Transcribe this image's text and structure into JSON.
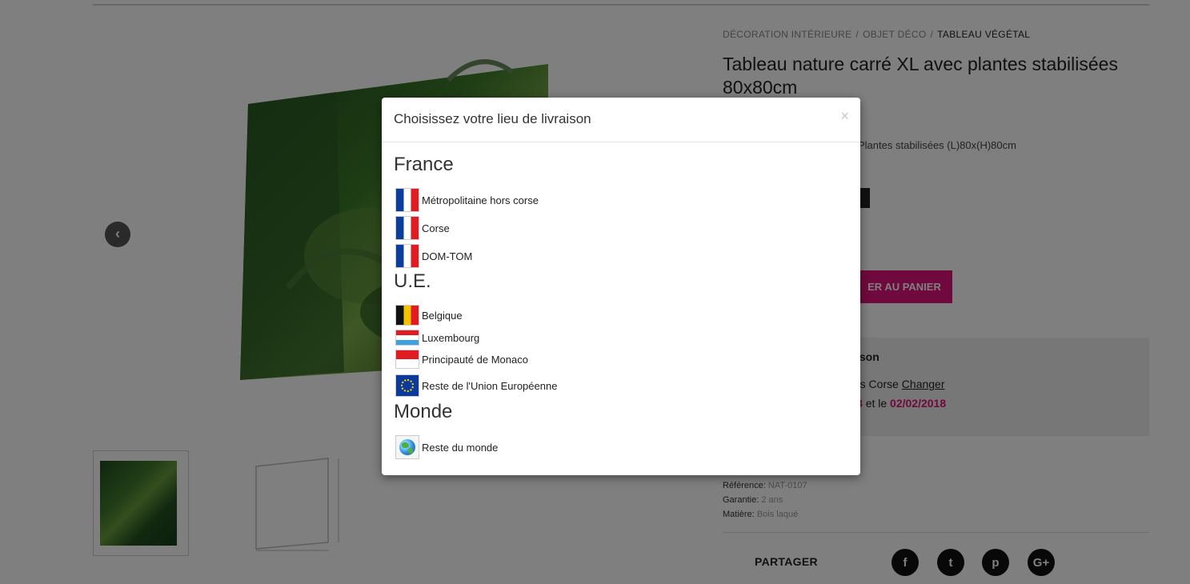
{
  "breadcrumb": [
    {
      "label": "DÉCORATION INTÉRIEURE"
    },
    {
      "label": "OBJET DÉCO"
    },
    {
      "label": "TABLEAU VÉGÉTAL"
    }
  ],
  "product": {
    "title": "Tableau nature carré XL avec plantes stabilisées 80x80cm",
    "description_visible": "Plantes stabilisées (L)80x(H)80cm",
    "add_to_cart_label": "ER AU PANIER",
    "delivery": {
      "title": "ison",
      "line1_text": "rs Corse",
      "change_link": "Changer",
      "line2_date1": "8",
      "line2_mid": "et le",
      "line2_date2": "02/02/2018"
    },
    "specs": [
      {
        "label": "Référence:",
        "value": "NAT-0107"
      },
      {
        "label": "Garantie:",
        "value": "2 ans"
      },
      {
        "label": "Matière:",
        "value": "Bois laqué"
      }
    ],
    "share_label": "PARTAGER",
    "social": [
      {
        "name": "facebook-icon",
        "glyph": "f"
      },
      {
        "name": "twitter-icon",
        "glyph": "t"
      },
      {
        "name": "pinterest-icon",
        "glyph": "p"
      },
      {
        "name": "google-plus-icon",
        "glyph": "G+"
      }
    ]
  },
  "modal": {
    "title": "Choisissez votre lieu de livraison",
    "close_glyph": "×",
    "regions": [
      {
        "heading": "France",
        "options": [
          "Métropolitaine hors corse",
          "Corse",
          "DOM-TOM"
        ]
      },
      {
        "heading": "U.E.",
        "options": [
          "Belgique",
          "Luxembourg",
          "Principauté de Monaco",
          "Reste de l'Union Européenne"
        ]
      },
      {
        "heading": "Monde",
        "options": [
          "Reste du monde"
        ]
      }
    ]
  },
  "colors": {
    "accent_pink": "#e0137a",
    "overlay": "rgba(0,0,0,0.5)"
  }
}
